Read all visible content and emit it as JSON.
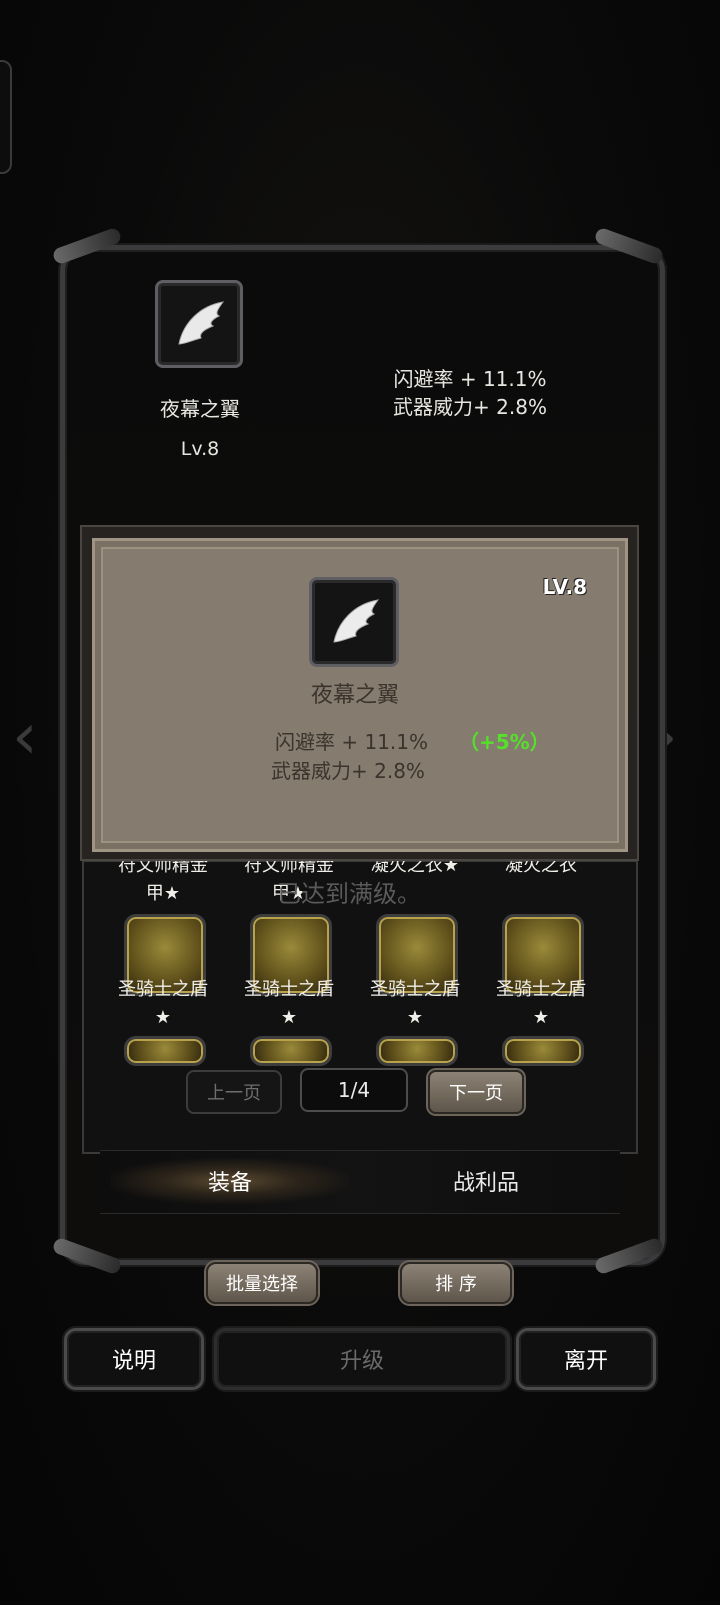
{
  "equipped": {
    "name": "夜幕之翼",
    "level": "Lv.8",
    "stats": [
      "闪避率 + 11.1%",
      "武器威力+ 2.8%"
    ]
  },
  "tooltip": {
    "level": "LV.8",
    "name": "夜幕之翼",
    "stats": [
      "闪避率 + 11.1%",
      "武器威力+ 2.8%"
    ],
    "bonus": "（+5%）"
  },
  "grid": {
    "partial_row": [
      "符文师精金",
      "符文师精金",
      "凝火之衣★",
      "凝火之衣"
    ],
    "partial_row_line2": [
      "甲★",
      "甲★"
    ],
    "overlay_text": "已达到满级。",
    "items": [
      {
        "name": "圣骑士之盾",
        "star": "★"
      },
      {
        "name": "圣骑士之盾",
        "star": "★"
      },
      {
        "name": "圣骑士之盾",
        "star": "★"
      },
      {
        "name": "圣骑士之盾",
        "star": "★"
      }
    ]
  },
  "pagination": {
    "prev": "上一页",
    "current": "1/4",
    "next": "下一页"
  },
  "tabs": {
    "equipment": "装备",
    "loot": "战利品"
  },
  "actions": {
    "batch": "批量选择",
    "sort": "排 序"
  },
  "bottom": {
    "help": "说明",
    "upgrade": "升级",
    "leave": "离开"
  },
  "colors": {
    "bonus_green": "#55e02a",
    "tooltip_bg": "#857b6f"
  },
  "icons": {
    "wing": "wing-icon",
    "shield": "shield-icon"
  }
}
